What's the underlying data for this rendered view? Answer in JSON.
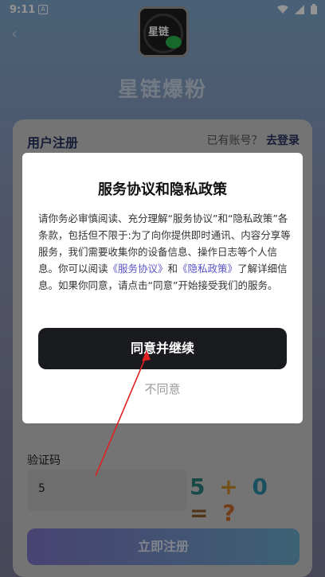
{
  "status_bar": {
    "time": "9:11",
    "notif_glyph": "A"
  },
  "app": {
    "name": "星链爆粉",
    "logo_text": "星链"
  },
  "register_card": {
    "title": "用户注册",
    "has_account": "已有账号？",
    "login_link": "去登录",
    "code_label": "验证码",
    "code_value": "5",
    "captcha_text": [
      "5",
      "+",
      "0",
      "=",
      "?"
    ],
    "register_button": "立即注册"
  },
  "dialog": {
    "title": "服务协议和隐私政策",
    "body_part1": "请你务必审慎阅读、充分理解“服务协议”和“隐私政策”各条款，包括但不限于:为了向你提供即时通讯、内容分享等服务，我们需要收集你的设备信息、操作日志等个人信息。你可以阅读",
    "link_service": "《服务协议》",
    "body_and": "和",
    "link_privacy": "《隐私政策》",
    "body_part2": "了解详细信息。如果你同意，请点击“同意”开始接受我们的服务。",
    "agree_button": "同意并继续",
    "disagree_button": "不同意"
  },
  "colors": {
    "accent": "#5b54c8",
    "primary_button": "#1a1b1f",
    "captcha": [
      "#2a7f7a",
      "#c88a2a",
      "#2b8aa6",
      "#8a5a2a",
      "#c86a2a"
    ]
  }
}
